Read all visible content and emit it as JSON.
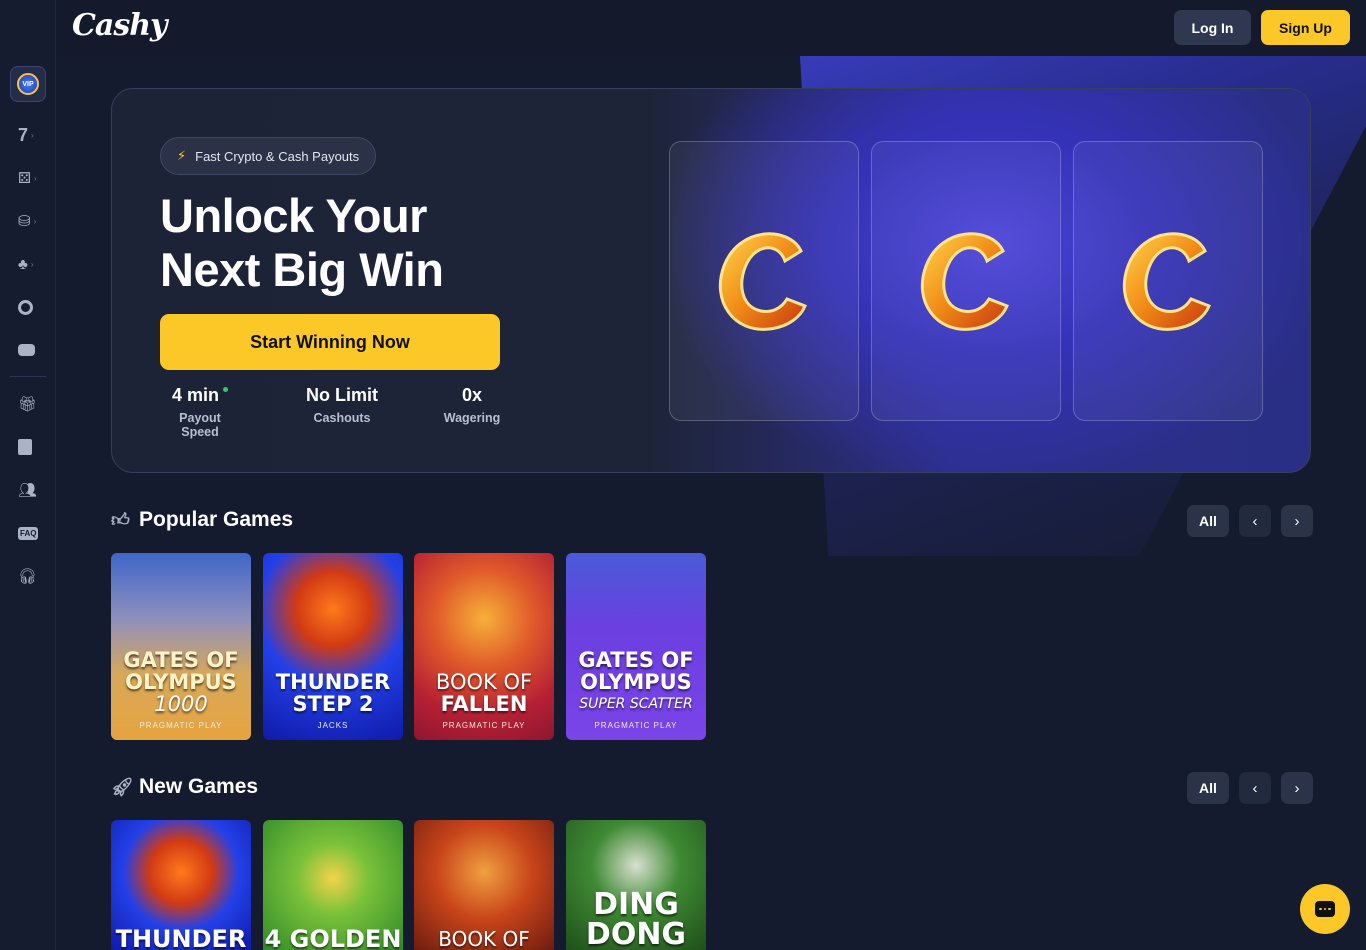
{
  "header": {
    "logo": "Cashy",
    "login_label": "Log In",
    "signup_label": "Sign Up"
  },
  "sidebar": {
    "vip_label": "VIP",
    "items": [
      {
        "icon": "seven-icon"
      },
      {
        "icon": "dice-icon"
      },
      {
        "icon": "live-casino-icon"
      },
      {
        "icon": "cherry-icon"
      },
      {
        "icon": "cashy-coin-icon"
      },
      {
        "icon": "gamepad-icon"
      },
      {
        "icon": "gift-icon"
      },
      {
        "icon": "document-icon"
      },
      {
        "icon": "users-icon"
      },
      {
        "icon": "faq-icon"
      },
      {
        "icon": "headset-icon"
      }
    ]
  },
  "hero": {
    "pill": "Fast Crypto & Cash Payouts",
    "headline_1": "Unlock Your",
    "headline_2": "Next Big Win",
    "cta": "Start Winning Now",
    "stats": [
      {
        "value": "4 min",
        "label": "Payout Speed"
      },
      {
        "value": "No Limit",
        "label": "Cashouts"
      },
      {
        "value": "0x",
        "label": "Wagering"
      }
    ],
    "slots": [
      "C",
      "C",
      "C"
    ]
  },
  "popular": {
    "title": "Popular Games",
    "all_label": "All",
    "games": [
      {
        "line1": "GATES OF",
        "line2": "OLYMPUS",
        "line3": "1000",
        "provider": "PRAGMATIC PLAY",
        "bg": "#e09d3e"
      },
      {
        "line1": "THUNDER",
        "line2": "STEP 2",
        "line3": "",
        "provider": "JACKS",
        "bg": "#1d2ed3"
      },
      {
        "line1": "BOOK OF",
        "line2": "FALLEN",
        "line3": "",
        "provider": "PRAGMATIC PLAY",
        "bg": "#b8233a"
      },
      {
        "line1": "GATES OF",
        "line2": "OLYMPUS",
        "line3": "SUPER SCATTER",
        "provider": "PRAGMATIC PLAY",
        "bg": "#5b3ee0"
      }
    ]
  },
  "new_games": {
    "title": "New Games",
    "all_label": "All",
    "games": [
      {
        "line1": "THUNDER",
        "bg": "#1d2ed3"
      },
      {
        "line1": "4 GOLDEN",
        "bg": "#3a9a2a"
      },
      {
        "line1": "BOOK OF",
        "bg": "#c9451a"
      },
      {
        "line1": "DING DONG",
        "bg": "#2f7a2c"
      }
    ]
  }
}
